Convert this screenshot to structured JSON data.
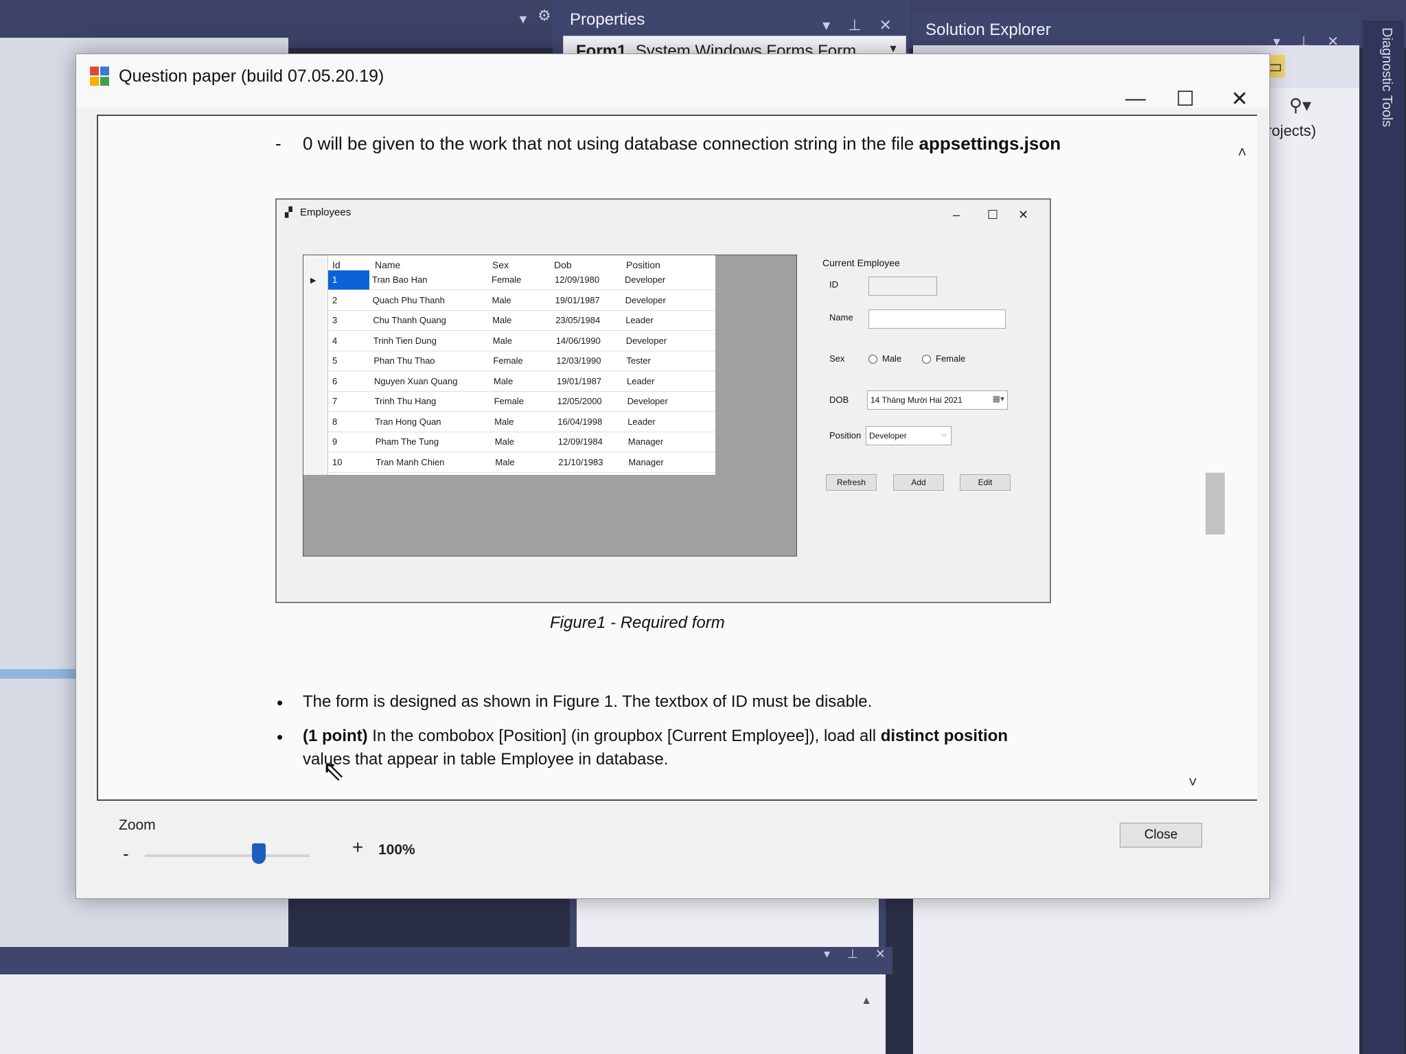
{
  "ide": {
    "properties": {
      "title": "Properties",
      "object_name": "Form1",
      "object_type": "System.Windows.Forms.Form"
    },
    "solution_explorer": {
      "title": "Solution Explorer",
      "projects_text": "rojects)"
    },
    "diagnostic_tools": "Diagnostic Tools"
  },
  "window": {
    "title": "Question paper (build 07.05.20.19)"
  },
  "doc": {
    "line1_text": "0 will be given to the work that not using database connection string in the file ",
    "line1_bold": "appsettings.json",
    "caption": "Figure1 - Required form",
    "bullet1": "The form is designed as shown in Figure 1. The textbox of ID must be disable.",
    "bullet2_bold": "(1 point)",
    "bullet2_text": " In the combobox [Position] (in groupbox [Current Employee]), load all ",
    "bullet2_bold2": "distinct position",
    "bullet2_line2": "values that appear in table Employee in database."
  },
  "figure": {
    "title": "Employees",
    "columns": [
      "Id",
      "Name",
      "Sex",
      "Dob",
      "Position"
    ],
    "rows": [
      [
        "1",
        "Tran Bao Han",
        "Female",
        "12/09/1980",
        "Developer"
      ],
      [
        "2",
        "Quach Phu Thanh",
        "Male",
        "19/01/1987",
        "Developer"
      ],
      [
        "3",
        "Chu Thanh Quang",
        "Male",
        "23/05/1984",
        "Leader"
      ],
      [
        "4",
        "Trinh Tien Dung",
        "Male",
        "14/06/1990",
        "Developer"
      ],
      [
        "5",
        "Phan Thu Thao",
        "Female",
        "12/03/1990",
        "Tester"
      ],
      [
        "6",
        "Nguyen Xuan Quang",
        "Male",
        "19/01/1987",
        "Leader"
      ],
      [
        "7",
        "Trinh Thu Hang",
        "Female",
        "12/05/2000",
        "Developer"
      ],
      [
        "8",
        "Tran Hong Quan",
        "Male",
        "16/04/1998",
        "Leader"
      ],
      [
        "9",
        "Pham The Tung",
        "Male",
        "12/09/1984",
        "Manager"
      ],
      [
        "10",
        "Tran Manh Chien",
        "Male",
        "21/10/1983",
        "Manager"
      ]
    ],
    "group_title": "Current Employee",
    "label_id": "ID",
    "label_name": "Name",
    "label_sex": "Sex",
    "radio_male": "Male",
    "radio_female": "Female",
    "label_dob": "DOB",
    "dob_value": "14 Tháng Mười Hai 2021",
    "label_position": "Position",
    "position_value": "Developer",
    "btn_refresh": "Refresh",
    "btn_add": "Add",
    "btn_edit": "Edit"
  },
  "bottom": {
    "zoom_label": "Zoom",
    "zoom_minus": "-",
    "zoom_plus": "+",
    "zoom_value": "100%",
    "close_label": "Close"
  }
}
